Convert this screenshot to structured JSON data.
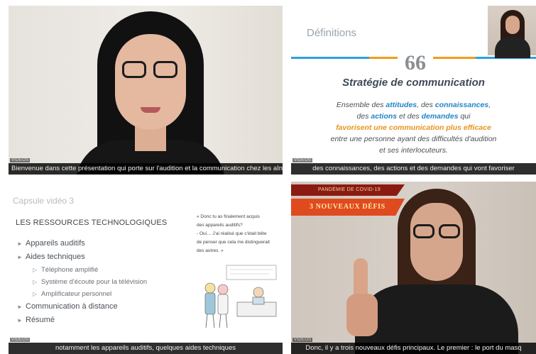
{
  "tiles": [
    {
      "caption": "Bienvenue dans cette présentation qui porte sur l'audition et la communication chez les aînés.",
      "corner": "VIDEOS"
    },
    {
      "caption": "des connaissances, des actions et des demandes qui vont favoriser",
      "corner": "VIDEOS",
      "slide": {
        "title": "Définitions",
        "quote_mark": "66",
        "heading": "Stratégie de communication",
        "line1_a": "Ensemble des ",
        "line1_b": "attitudes",
        "line1_c": ", des ",
        "line1_d": "connaissances",
        "line1_e": ",",
        "line2_a": "des ",
        "line2_b": "actions",
        "line2_c": " et des ",
        "line2_d": "demandes",
        "line2_e": " qui",
        "line3": "favorisent une communication plus efficace",
        "line4": "entre une personne ayant des difficultés d'audition",
        "line5": "et ses interlocuteurs."
      }
    },
    {
      "caption": "notamment les appareils auditifs, quelques aides techniques",
      "corner": "VIDEOS",
      "slide": {
        "title": "Capsule vidéo 3",
        "heading": "LES RESSOURCES TECHNOLOGIQUES",
        "items": [
          {
            "label": "Appareils auditifs",
            "sub": false
          },
          {
            "label": "Aides techniques",
            "sub": false
          },
          {
            "label": "Téléphone amplifié",
            "sub": true
          },
          {
            "label": "Système d'écoute pour la télévision",
            "sub": true
          },
          {
            "label": "Amplificateur personnel",
            "sub": true
          },
          {
            "label": "Communication à distance",
            "sub": false
          },
          {
            "label": "Résumé",
            "sub": false
          }
        ],
        "quote_lines": [
          "« Donc tu as finalement acquis",
          "des appareils auditifs?",
          "- Oui… J'ai réalisé que c'était bête",
          "de penser que cela me distinguerait",
          "des autres. »"
        ]
      }
    },
    {
      "caption": "Donc, il y a trois nouveaux défis principaux. Le premier : le port du masq",
      "corner": "VIDEOS",
      "banner_top": "PANDÉMIE DE COVID-19",
      "banner_main": "3 NOUVEAUX DÉFIS"
    }
  ],
  "colors": {
    "blue_accent": "#2aa3dc",
    "orange_accent": "#f39a1c",
    "banner_red": "#e04a1f"
  }
}
